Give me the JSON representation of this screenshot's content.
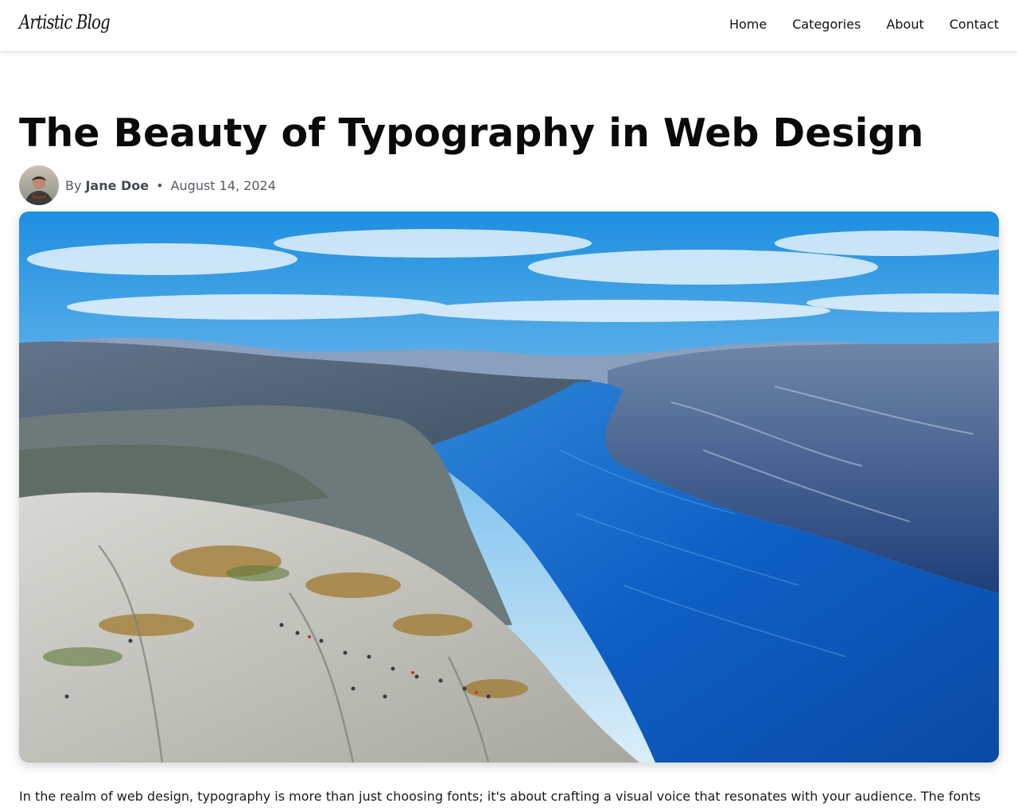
{
  "header": {
    "logo": "Artistic Blog",
    "nav": [
      "Home",
      "Categories",
      "About",
      "Contact"
    ]
  },
  "article": {
    "title": "The Beauty of Typography in Web Design",
    "byline_prefix": "By",
    "author": "Jane Doe",
    "separator": "•",
    "date": "August 14, 2024",
    "intro": "In the realm of web design, typography is more than just choosing fonts; it's about crafting a visual voice that resonates with your audience. The fonts"
  },
  "images": {
    "author_avatar": "author photo (person with scarf)",
    "hero": "aerial view of fjord with rocky cliff plateau and people"
  },
  "colors": {
    "text": "#111111",
    "meta": "#555a63",
    "background": "#ffffff"
  }
}
